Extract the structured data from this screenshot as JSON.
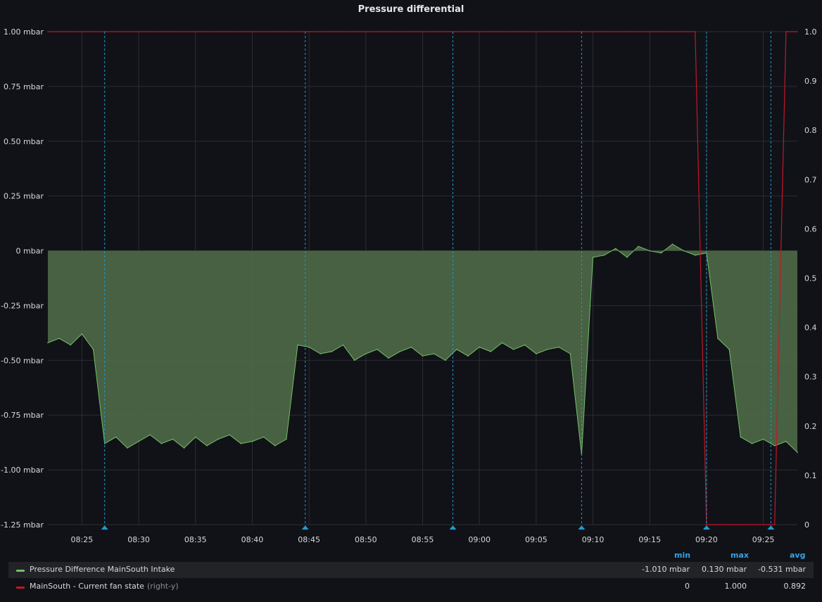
{
  "panel": {
    "title": "Pressure differential"
  },
  "colors": {
    "pressure": "#73bf69",
    "pressure_fill": "#4b6645",
    "fan": "#c4162a",
    "annotation": "#1f9bd1",
    "grid": "#2c2d32",
    "tick": "#d8d9da"
  },
  "chart_data": {
    "type": "area",
    "x": [
      "08:22",
      "08:23",
      "08:24",
      "08:25",
      "08:26",
      "08:27",
      "08:28",
      "08:29",
      "08:30",
      "08:31",
      "08:32",
      "08:33",
      "08:34",
      "08:35",
      "08:36",
      "08:37",
      "08:38",
      "08:39",
      "08:40",
      "08:41",
      "08:42",
      "08:43",
      "08:44",
      "08:45",
      "08:46",
      "08:47",
      "08:48",
      "08:49",
      "08:50",
      "08:51",
      "08:52",
      "08:53",
      "08:54",
      "08:55",
      "08:56",
      "08:57",
      "08:58",
      "08:59",
      "09:00",
      "09:01",
      "09:02",
      "09:03",
      "09:04",
      "09:05",
      "09:06",
      "09:07",
      "09:08",
      "09:09",
      "09:10",
      "09:11",
      "09:12",
      "09:13",
      "09:14",
      "09:15",
      "09:16",
      "09:17",
      "09:18",
      "09:19",
      "09:20",
      "09:21",
      "09:22",
      "09:23",
      "09:24",
      "09:25",
      "09:26",
      "09:27",
      "09:28"
    ],
    "x_ticks": [
      "08:25",
      "08:30",
      "08:35",
      "08:40",
      "08:45",
      "08:50",
      "08:55",
      "09:00",
      "09:05",
      "09:10",
      "09:15",
      "09:20",
      "09:25"
    ],
    "series": [
      {
        "name": "Pressure Difference MainSouth Intake",
        "axis": "left",
        "values": [
          -0.42,
          -0.4,
          -0.43,
          -0.38,
          -0.45,
          -0.88,
          -0.85,
          -0.9,
          -0.87,
          -0.84,
          -0.88,
          -0.86,
          -0.9,
          -0.85,
          -0.89,
          -0.86,
          -0.84,
          -0.88,
          -0.87,
          -0.85,
          -0.89,
          -0.86,
          -0.43,
          -0.44,
          -0.47,
          -0.46,
          -0.43,
          -0.5,
          -0.47,
          -0.45,
          -0.49,
          -0.46,
          -0.44,
          -0.48,
          -0.47,
          -0.5,
          -0.45,
          -0.48,
          -0.44,
          -0.46,
          -0.42,
          -0.45,
          -0.43,
          -0.47,
          -0.45,
          -0.44,
          -0.47,
          -0.93,
          -0.03,
          -0.02,
          0.01,
          -0.03,
          0.02,
          0.0,
          -0.01,
          0.03,
          0.0,
          -0.02,
          -0.01,
          -0.4,
          -0.45,
          -0.85,
          -0.88,
          -0.86,
          -0.89,
          -0.87,
          -0.92
        ]
      },
      {
        "name": "MainSouth - Current fan state",
        "axis": "right",
        "values": [
          1,
          1,
          1,
          1,
          1,
          1,
          1,
          1,
          1,
          1,
          1,
          1,
          1,
          1,
          1,
          1,
          1,
          1,
          1,
          1,
          1,
          1,
          1,
          1,
          1,
          1,
          1,
          1,
          1,
          1,
          1,
          1,
          1,
          1,
          1,
          1,
          1,
          1,
          1,
          1,
          1,
          1,
          1,
          1,
          1,
          1,
          1,
          1,
          1,
          1,
          1,
          1,
          1,
          1,
          1,
          1,
          1,
          1,
          0,
          0,
          0,
          0,
          0,
          0,
          0,
          1,
          1
        ]
      }
    ],
    "left_axis": {
      "ticks": [
        "1.00 mbar",
        "0.75 mbar",
        "0.50 mbar",
        "0.25 mbar",
        "0 mbar",
        "-0.25 mbar",
        "-0.50 mbar",
        "-0.75 mbar",
        "-1.00 mbar",
        "-1.25 mbar"
      ],
      "ylim": [
        -1.25,
        1.0
      ]
    },
    "right_axis": {
      "ticks": [
        "1.0",
        "0.9",
        "0.8",
        "0.7",
        "0.6",
        "0.5",
        "0.4",
        "0.3",
        "0.2",
        "0.1",
        "0"
      ],
      "ylim": [
        0,
        1.0
      ]
    },
    "annotations": [
      "08:27",
      "08:44:40",
      "08:57:40",
      "09:09",
      "09:20",
      "09:25:40"
    ],
    "grid": true,
    "legend_position": "bottom"
  },
  "legend": {
    "headers": {
      "min": "min",
      "max": "max",
      "avg": "avg"
    },
    "rows": [
      {
        "name": "Pressure Difference MainSouth Intake",
        "note": "",
        "min": "-1.010 mbar",
        "max": "0.130 mbar",
        "avg": "-0.531 mbar"
      },
      {
        "name": "MainSouth - Current fan state",
        "note": "(right-y)",
        "min": "0",
        "max": "1.000",
        "avg": "0.892"
      }
    ]
  }
}
